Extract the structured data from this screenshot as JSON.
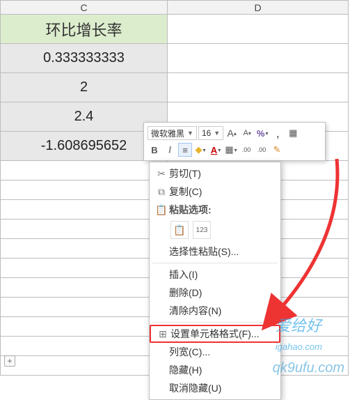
{
  "columns": {
    "c": "C",
    "d": "D"
  },
  "header": {
    "c": "环比增长率"
  },
  "rows": [
    {
      "c": "0.333333333"
    },
    {
      "c": "2"
    },
    {
      "c": "2.4"
    },
    {
      "c": "-1.608695652"
    }
  ],
  "expand_btn": "+",
  "mini_toolbar": {
    "font_name": "微软雅黑",
    "font_size": "16",
    "grow": "A",
    "shrink": "A",
    "currency": "%",
    "comma": ",",
    "bold": "B",
    "italic": "I",
    "align": "≡",
    "fill_glyph": "◆",
    "font_color": "A",
    "borders": "▦",
    "inc_dec": ".00",
    "brush": "✎"
  },
  "context_menu": {
    "cut": {
      "label": "剪切",
      "key": "T",
      "icon": "✂"
    },
    "copy": {
      "label": "复制",
      "key": "C",
      "icon": "⧉"
    },
    "paste_hdr": {
      "label": "粘贴选项:",
      "icon": "📋"
    },
    "paste_opt1": "📋",
    "paste_opt2": "123",
    "paste_special": {
      "label": "选择性粘贴",
      "key": "S"
    },
    "insert": {
      "label": "插入",
      "key": "I"
    },
    "delete": {
      "label": "删除",
      "key": "D"
    },
    "clear": {
      "label": "清除内容",
      "key": "N"
    },
    "format": {
      "label": "设置单元格格式",
      "key": "F",
      "icon": "⊞"
    },
    "colwidth": {
      "label": "列宽",
      "key": "C"
    },
    "hide": {
      "label": "隐藏",
      "key": "H"
    },
    "unhide": {
      "label": "取消隐藏",
      "key": "U"
    }
  },
  "watermark": {
    "brand1": "爱给好",
    "brand2": "igahao.com",
    "other": "qk9ufu.com"
  }
}
